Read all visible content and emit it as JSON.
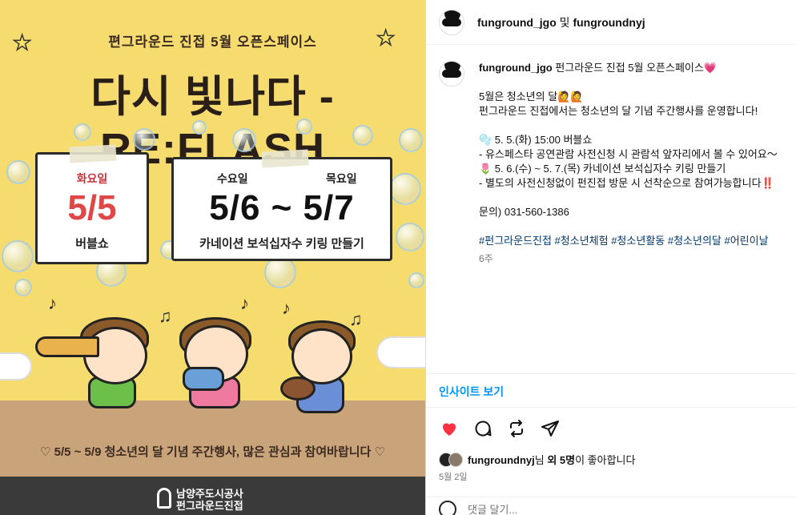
{
  "poster": {
    "subtitle": "편그라운드 진접 5월 오픈스페이스",
    "title": "다시 빛나다 - RE:FLASH",
    "card1": {
      "day": "화요일",
      "date": "5/5",
      "desc": "버블쇼"
    },
    "card2": {
      "day1": "수요일",
      "day2": "목요일",
      "date": "5/6 ~ 5/7",
      "desc": "카네이션 보석십자수 키링 만들기"
    },
    "bottom_line": "♡ 5/5 ~ 5/9 청소년의 달 기념 주간행사, 많은 관심과 참여바랍니다 ♡",
    "logo_line1": "남양주도시공사",
    "logo_line2": "펀그라운드진접"
  },
  "post": {
    "header_user1": "funground_jgo",
    "header_and": "및",
    "header_user2": "fungroundnyj",
    "caption_user": "funground_jgo",
    "caption_title": "펀그라운드 진접 5월 오픈스페이스💗",
    "lines": [
      "5월은 청소년의 달🙋🙋",
      "펀그라운드 진접에서는 청소년의 달 기념 주간행사를 운영합니다!",
      "🫧 5. 5.(화) 15:00 버블쇼",
      "- 유스페스타 공연관람 사전신청 시 관람석 앞자리에서 볼 수 있어요〜",
      "🌷 5. 6.(수) ~ 5. 7.(목) 카네이션 보석십자수 키링 만들기",
      "- 별도의 사전신청없이 펀진접 방문 시 선착순으로 참여가능합니다‼️",
      "문의) 031-560-1386"
    ],
    "hashtags": "#펀그라운드진접 #청소년체험 #청소년활동 #청소년의달 #어린이날",
    "time_ago": "6주",
    "insights_label": "인사이트 보기",
    "likes_user": "fungroundnyj",
    "likes_mid": "님 ",
    "likes_others": "외 5명",
    "likes_tail": "이 좋아합니다",
    "date": "5월 2일",
    "comment_placeholder": "댓글 달기..."
  },
  "colors": {
    "like_red": "#ff3040",
    "link_blue": "#0095f6",
    "hashtag": "#00376b",
    "poster_bg": "#f6dc6f"
  },
  "icons": [
    "heart-icon",
    "comment-icon",
    "repost-icon",
    "share-icon",
    "emoji-icon"
  ]
}
